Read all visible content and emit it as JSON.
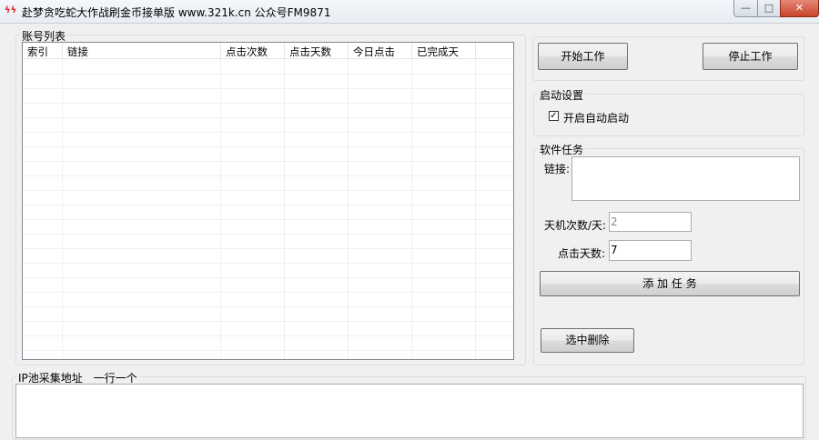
{
  "window": {
    "title": "赴梦贪吃蛇大作战刷金币接单版 www.321k.cn   公众号FM9871",
    "minimize": "—",
    "maximize": "□",
    "close": "✕"
  },
  "accounts": {
    "group_label": "账号列表",
    "columns": [
      "索引",
      "链接",
      "点击次数",
      "点击天数",
      "今日点击",
      "已完成天"
    ]
  },
  "controls": {
    "start": "开始工作",
    "stop": "停止工作"
  },
  "startup": {
    "group_label": "启动设置",
    "autostart_label": "开启自动启动",
    "autostart_checked": true
  },
  "task": {
    "group_label": "软件任务",
    "link_label": "链接:",
    "link_value": "",
    "daily_label": "天机次数/天:",
    "daily_value": "2",
    "days_label": "点击天数:",
    "days_value": "7",
    "add": "添 加 任 务",
    "delete": "选中删除"
  },
  "ip_pool": {
    "group_label": "IP池采集地址__一行一个",
    "value": ""
  }
}
